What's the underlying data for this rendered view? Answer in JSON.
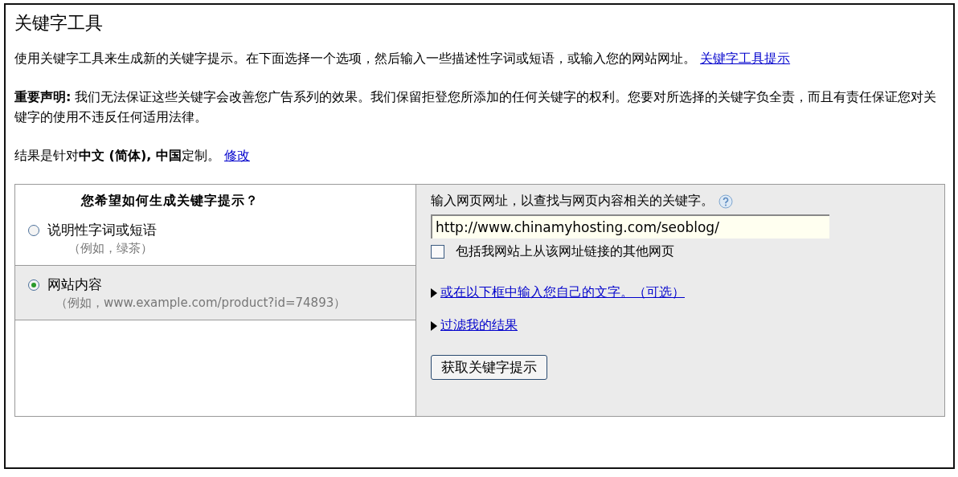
{
  "title": "关键字工具",
  "intro": {
    "text": "使用关键字工具来生成新的关键字提示。在下面选择一个选项，然后输入一些描述性字词或短语，或输入您的网站网址。",
    "link": "关键字工具提示"
  },
  "notice": "**重要声明:** 我们无法保证这些关键字会改善您广告系列的效果。我们保留拒登您所添加的任何关键字的权利。您要对所选择的关键字负全责，而且有责任保证您对关键字的使用不违反任何适用法律。",
  "locale": {
    "text": "结果是针对**中文 (简体), 中国**定制。",
    "link": "修改"
  },
  "options_heading": "您希望如何生成关键字提示？",
  "options": [
    {
      "label": "说明性字词或短语",
      "hint": "（例如，绿茶）",
      "selected": false
    },
    {
      "label": "网站内容",
      "hint": "（例如，www.example.com/product?id=74893）",
      "selected": true
    }
  ],
  "url_prompt": "输入网页网址，以查找与网页内容相关的关键字。",
  "url_value": "http://www.chinamyhosting.com/seoblog/",
  "include_linked": {
    "label": "包括我网站上从该网址链接的其他网页",
    "checked": false
  },
  "expanders": [
    {
      "label": "或在以下框中输入您自己的文字。（可选）",
      "expanded": false
    },
    {
      "label": "过滤我的结果",
      "expanded": false
    }
  ],
  "submit": "获取关键字提示"
}
